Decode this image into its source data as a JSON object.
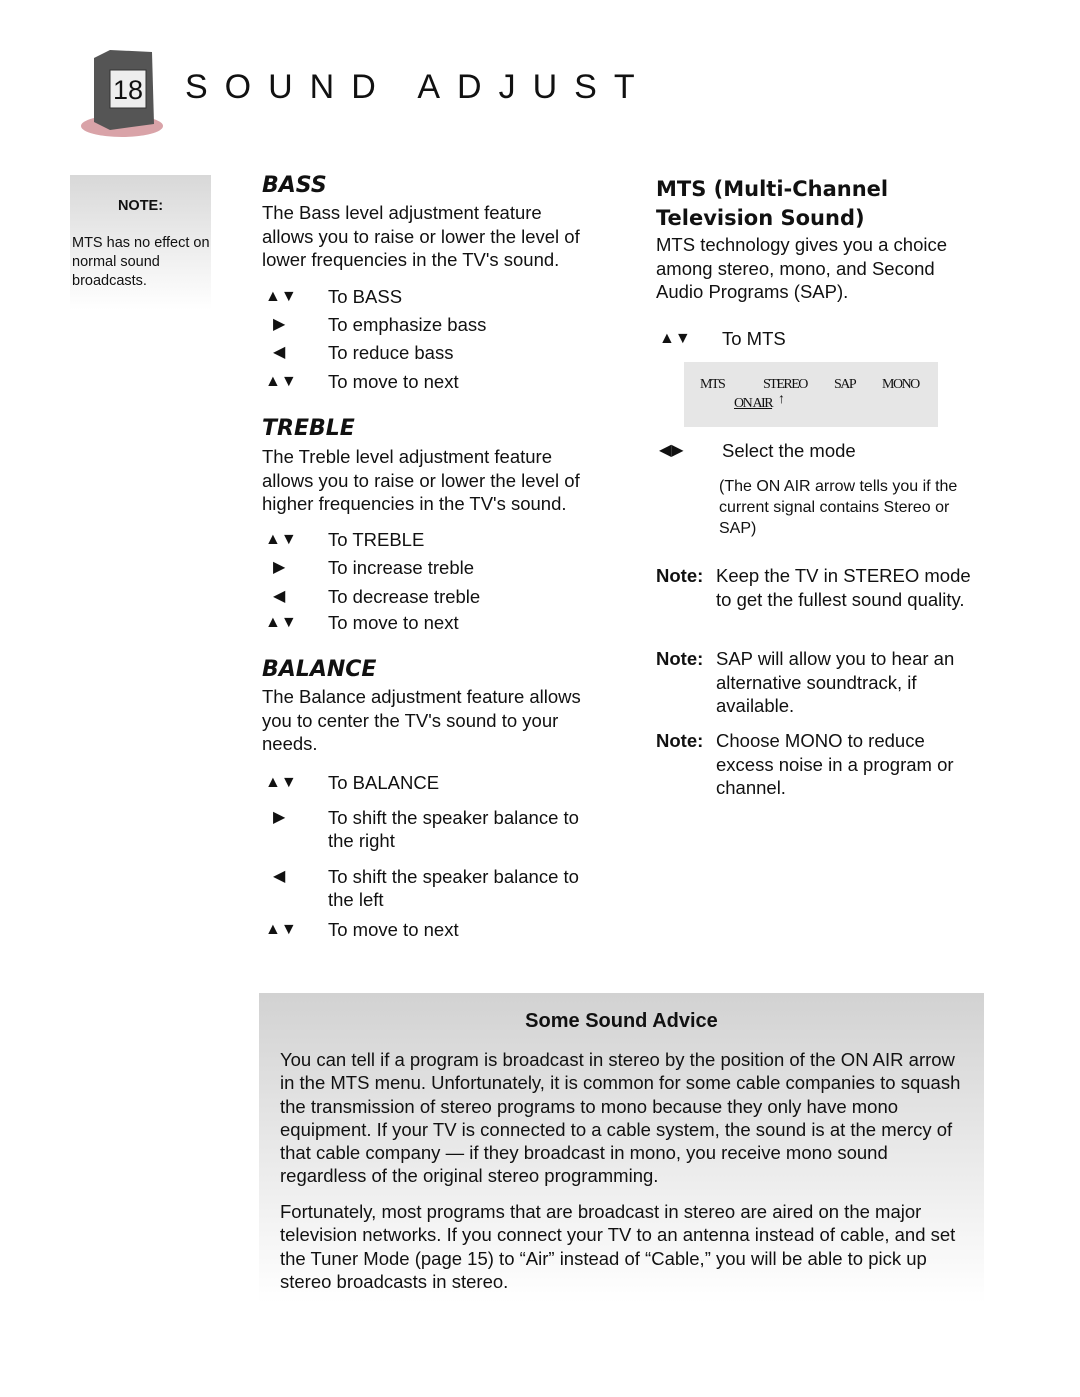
{
  "header": {
    "page_number": "18",
    "title": "SOUND ADJUST"
  },
  "side_note": {
    "label": "NOTE:",
    "text": "MTS has no effect on normal sound broadcasts."
  },
  "bass": {
    "heading": "BASS",
    "text": "The Bass level adjustment feature allows you to raise or lower the level of lower frequencies in the TV's sound.",
    "steps": [
      {
        "icon": "▲▼",
        "text": "To BASS"
      },
      {
        "icon": "▶",
        "text": "To emphasize bass"
      },
      {
        "icon": "◀",
        "text": "To reduce bass"
      },
      {
        "icon": "▲▼",
        "text": "To move to next"
      }
    ]
  },
  "treble": {
    "heading": "TREBLE",
    "text": "The Treble level adjustment feature allows you to raise or lower the level of higher frequencies in the TV's sound.",
    "steps": [
      {
        "icon": "▲▼",
        "text": "To TREBLE"
      },
      {
        "icon": "▶",
        "text": "To increase treble"
      },
      {
        "icon": "◀",
        "text": "To decrease treble"
      },
      {
        "icon": "▲▼",
        "text": "To move to next"
      }
    ]
  },
  "balance": {
    "heading": "BALANCE",
    "text": "The Balance adjustment feature allows you to center the TV's sound to your needs.",
    "steps": [
      {
        "icon": "▲▼",
        "text": "To BALANCE"
      },
      {
        "icon": "▶",
        "text": "To shift the speaker balance to the right"
      },
      {
        "icon": "◀",
        "text": "To shift the speaker balance to the left"
      },
      {
        "icon": "▲▼",
        "text": "To move to next"
      }
    ]
  },
  "mts": {
    "heading_line1": "MTS (Multi-Channel",
    "heading_line2": "Television Sound)",
    "text": "MTS technology gives you a choice among stereo, mono, and Second Audio Programs (SAP).",
    "step1": {
      "icon": "▲▼",
      "text": "To MTS"
    },
    "menu": {
      "label": "MTS",
      "options": [
        "STEREO",
        "SAP",
        "MONO"
      ],
      "on_air": "ON AIR"
    },
    "step2": {
      "icon": "◀▶",
      "text": "Select the mode"
    },
    "step2_note": "(The ON AIR arrow tells you if the current signal contains Stereo or SAP)",
    "notes": [
      {
        "label": "Note:",
        "text": "Keep the TV in STEREO mode to get the fullest sound quality."
      },
      {
        "label": "Note:",
        "text": "SAP will allow you to hear an alternative soundtrack, if available."
      },
      {
        "label": "Note:",
        "text": "Choose MONO to reduce excess noise in a program or channel."
      }
    ]
  },
  "advice": {
    "heading": "Some Sound Advice",
    "p1": "You can tell if a program is broadcast in stereo by the position of the ON AIR arrow in the MTS menu. Unfortunately, it is common for some cable companies to squash the transmission of stereo programs to mono because they only have mono equipment. If your TV is connected to a cable system, the sound is at the mercy of that cable company — if they broadcast in mono, you receive mono sound regardless of the original stereo programming.",
    "p2": "Fortunately, most programs that are broadcast in stereo are aired on the major television networks. If you connect your TV to an antenna instead of cable, and set the Tuner Mode (page 15) to “Air” instead of “Cable,” you will be able to pick up stereo broadcasts in stereo."
  }
}
